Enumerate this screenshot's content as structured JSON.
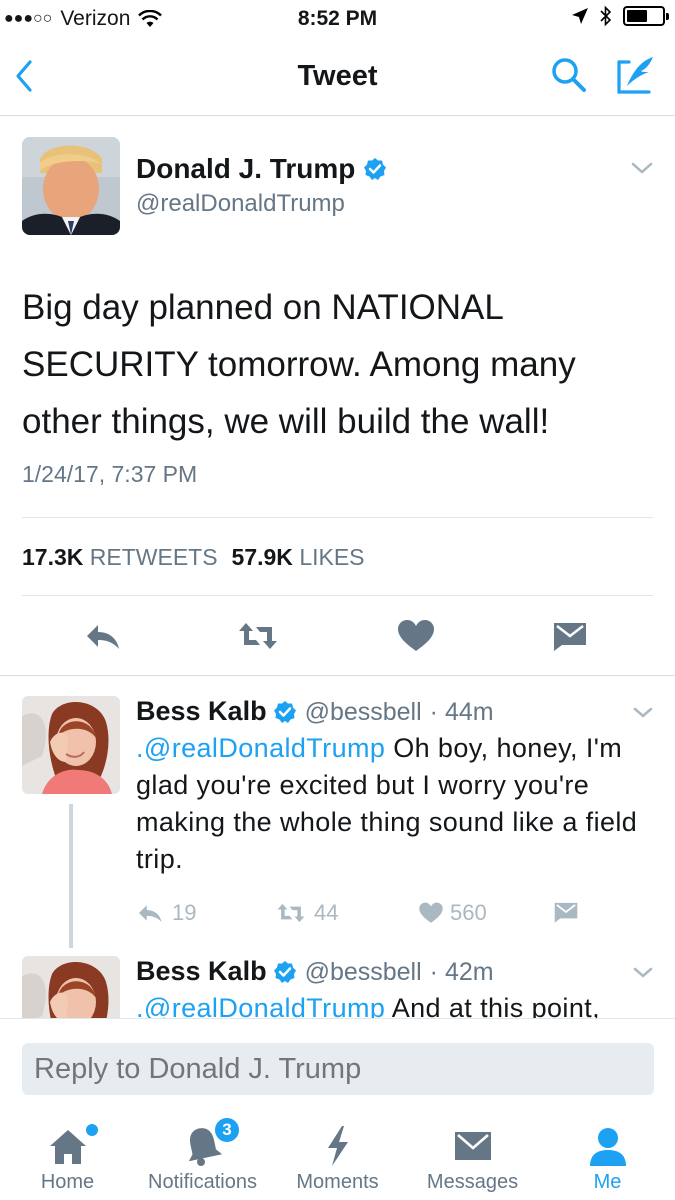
{
  "status_bar": {
    "signal_dots": "●●●○○",
    "carrier": "Verizon",
    "time": "8:52 PM",
    "battery_level": 0.6
  },
  "navbar": {
    "title": "Tweet"
  },
  "main_tweet": {
    "author_name": "Donald J. Trump",
    "author_handle": "@realDonaldTrump",
    "text": "Big day planned on NATIONAL SECURITY tomorrow. Among many other things, we will build the wall!",
    "date": "1/24/17, 7:37 PM",
    "retweets_count": "17.3K",
    "retweets_label": "RETWEETS",
    "likes_count": "57.9K",
    "likes_label": "LIKES"
  },
  "replies": [
    {
      "author_name": "Bess Kalb",
      "author_handle": "@bessbell",
      "time": "· 44m",
      "mention": ".@realDonaldTrump",
      "text": " Oh boy, honey, I'm glad you're excited but I worry you're making the whole thing sound like a field trip.",
      "reply_count": "19",
      "retweet_count": "44",
      "like_count": "560"
    },
    {
      "author_name": "Bess Kalb",
      "author_handle": "@bessbell",
      "time": "· 42m",
      "mention": ".@realDonaldTrump",
      "text": " And at this point,"
    }
  ],
  "reply_bar": {
    "placeholder": "Reply to Donald J. Trump"
  },
  "tabbar": {
    "tabs": [
      {
        "label": "Home",
        "icon": "home-icon"
      },
      {
        "label": "Notifications",
        "icon": "bell-icon",
        "badge": "3"
      },
      {
        "label": "Moments",
        "icon": "lightning-icon"
      },
      {
        "label": "Messages",
        "icon": "envelope-icon"
      },
      {
        "label": "Me",
        "icon": "person-icon"
      }
    ]
  },
  "colors": {
    "accent": "#1da1f2",
    "text": "#14171a",
    "secondary": "#657786",
    "icon_gray": "#657786",
    "light_icon": "#aab8c2"
  }
}
